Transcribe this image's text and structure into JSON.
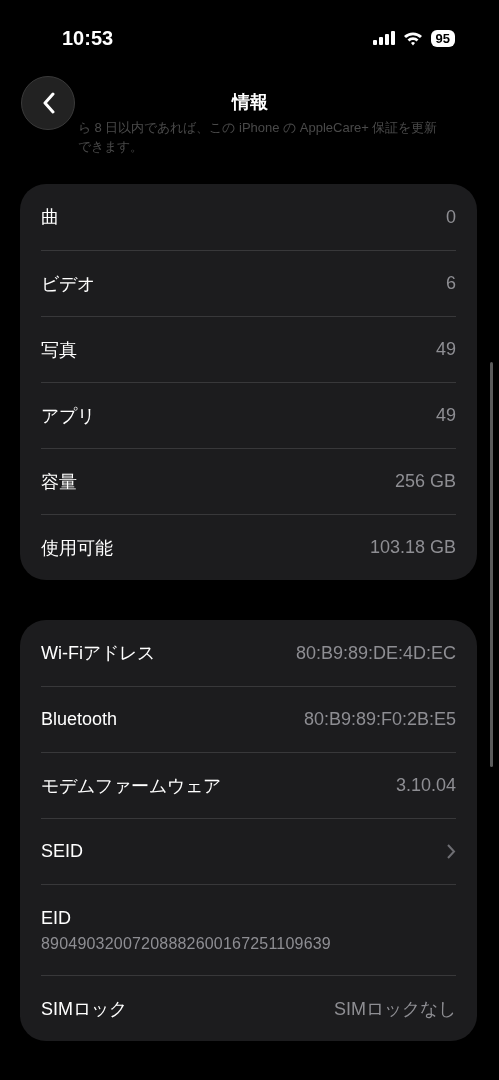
{
  "status_bar": {
    "time": "10:53",
    "battery": "95"
  },
  "nav": {
    "title": "情報"
  },
  "footnote": "ら 8 日以内であれば、この iPhone の AppleCare+ 保証を更新できます。",
  "sections": [
    {
      "rows": [
        {
          "kind": "value",
          "label": "曲",
          "value": "0"
        },
        {
          "kind": "value",
          "label": "ビデオ",
          "value": "6"
        },
        {
          "kind": "value",
          "label": "写真",
          "value": "49"
        },
        {
          "kind": "value",
          "label": "アプリ",
          "value": "49"
        },
        {
          "kind": "value",
          "label": "容量",
          "value": "256 GB"
        },
        {
          "kind": "value",
          "label": "使用可能",
          "value": "103.18 GB"
        }
      ]
    },
    {
      "rows": [
        {
          "kind": "value",
          "label": "Wi-Fiアドレス",
          "value": "80:B9:89:DE:4D:EC"
        },
        {
          "kind": "value",
          "label": "Bluetooth",
          "value": "80:B9:89:F0:2B:E5"
        },
        {
          "kind": "value",
          "label": "モデムファームウェア",
          "value": "3.10.04"
        },
        {
          "kind": "link",
          "label": "SEID"
        },
        {
          "kind": "stacked",
          "label": "EID",
          "value": "89049032007208882600167251109639"
        },
        {
          "kind": "value",
          "label": "SIMロック",
          "value": "SIMロックなし"
        }
      ]
    }
  ]
}
